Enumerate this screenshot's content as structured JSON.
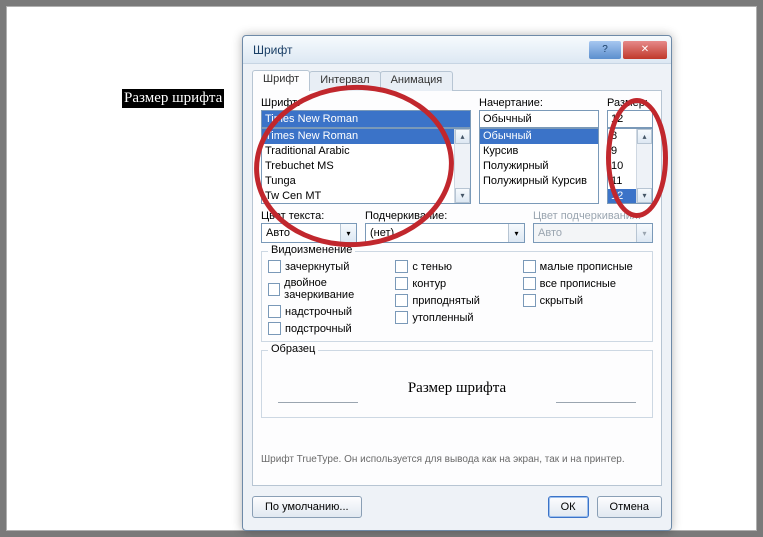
{
  "document": {
    "selected_text": "Размер шрифта"
  },
  "window": {
    "title": "Шрифт",
    "tabs": {
      "font": "Шрифт",
      "interval": "Интервал",
      "animation": "Анимация"
    },
    "labels": {
      "font": "Шрифт:",
      "style": "Начертание:",
      "size": "Размер:",
      "color": "Цвет текста:",
      "underline": "Подчеркивание:",
      "underline_color": "Цвет подчеркивания:",
      "effects_group": "Видоизменение",
      "sample_group": "Образец"
    },
    "font": {
      "value": "Times New Roman",
      "options": [
        "Times New Roman",
        "Traditional Arabic",
        "Trebuchet MS",
        "Tunga",
        "Tw Cen MT"
      ]
    },
    "style": {
      "value": "Обычный",
      "options": [
        "Обычный",
        "Курсив",
        "Полужирный",
        "Полужирный Курсив"
      ]
    },
    "size": {
      "value": "12",
      "options": [
        "8",
        "9",
        "10",
        "11",
        "12"
      ]
    },
    "color": {
      "value": "Авто"
    },
    "underline": {
      "value": "(нет)"
    },
    "underline_color": {
      "value": "Авто"
    },
    "effects": {
      "col1": [
        "зачеркнутый",
        "двойное зачеркивание",
        "надстрочный",
        "подстрочный"
      ],
      "col2": [
        "с тенью",
        "контур",
        "приподнятый",
        "утопленный"
      ],
      "col3": [
        "малые прописные",
        "все прописные",
        "скрытый"
      ]
    },
    "sample_text": "Размер шрифта",
    "footnote": "Шрифт TrueType. Он используется для вывода как на экран, так и на принтер.",
    "buttons": {
      "default": "По умолчанию...",
      "ok": "ОК",
      "cancel": "Отмена"
    }
  }
}
